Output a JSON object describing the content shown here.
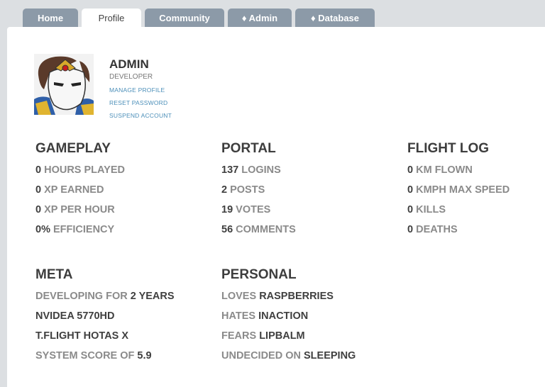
{
  "tabs": [
    {
      "label": "Home"
    },
    {
      "label": "Profile"
    },
    {
      "label": "Community"
    },
    {
      "label": "♦ Admin"
    },
    {
      "label": "♦ Database"
    }
  ],
  "profile": {
    "username": "ADMIN",
    "role": "DEVELOPER",
    "links": [
      "MANAGE PROFILE",
      "RESET PASSWORD",
      "SUSPEND ACCOUNT"
    ]
  },
  "sections": {
    "gameplay": {
      "title": "GAMEPLAY",
      "stats": [
        {
          "value": "0",
          "label": "HOURS PLAYED"
        },
        {
          "value": "0",
          "label": "XP EARNED"
        },
        {
          "value": "0",
          "label": "XP PER HOUR"
        },
        {
          "value": "0%",
          "label": "EFFICIENCY"
        }
      ]
    },
    "portal": {
      "title": "PORTAL",
      "stats": [
        {
          "value": "137",
          "label": "LOGINS"
        },
        {
          "value": "2",
          "label": "POSTS"
        },
        {
          "value": "19",
          "label": "VOTES"
        },
        {
          "value": "56",
          "label": "COMMENTS"
        }
      ]
    },
    "flight_log": {
      "title": "FLIGHT LOG",
      "stats": [
        {
          "value": "0",
          "label": "KM FLOWN"
        },
        {
          "value": "0",
          "label": "KMPH MAX SPEED"
        },
        {
          "value": "0",
          "label": "KILLS"
        },
        {
          "value": "0",
          "label": "DEATHS"
        }
      ]
    },
    "meta": {
      "title": "META",
      "stats": [
        {
          "pre": "DEVELOPING FOR",
          "strong": "2 YEARS"
        },
        {
          "pre": "",
          "strong": "NVIDEA 5770HD"
        },
        {
          "pre": "",
          "strong": "T.FLIGHT HOTAS X"
        },
        {
          "pre": "SYSTEM SCORE OF",
          "strong": "5.9"
        }
      ]
    },
    "personal": {
      "title": "PERSONAL",
      "stats": [
        {
          "pre": "LOVES",
          "strong": "RASPBERRIES"
        },
        {
          "pre": "HATES",
          "strong": "INACTION"
        },
        {
          "pre": "FEARS",
          "strong": "LIPBALM"
        },
        {
          "pre": "UNDECIDED ON",
          "strong": "SLEEPING"
        }
      ]
    }
  },
  "colors": {
    "tab_bg": "#8c9aa8",
    "page_bg": "#dcdfe2",
    "link": "#4c8fb9",
    "stat_strong": "#3f3f3f",
    "stat_light": "#8a8a8a"
  }
}
